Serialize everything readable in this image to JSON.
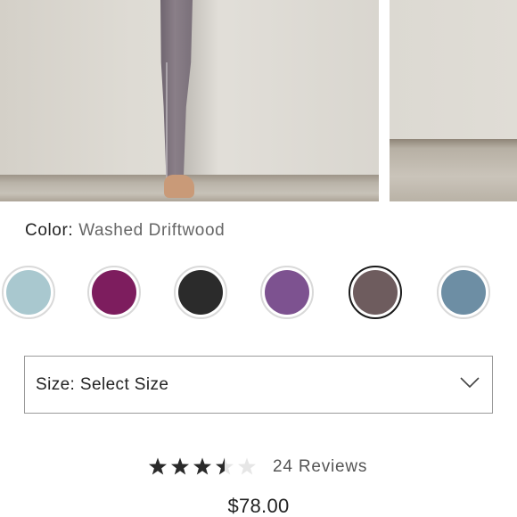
{
  "product": {
    "color_label": "Color:",
    "color_value": "Washed Driftwood",
    "swatches": [
      {
        "name": "light-blue",
        "color": "#a9c8cf",
        "selected": false
      },
      {
        "name": "magenta",
        "color": "#7d1d5e",
        "selected": false
      },
      {
        "name": "black",
        "color": "#2b2b2b",
        "selected": false
      },
      {
        "name": "purple",
        "color": "#7d5290",
        "selected": false
      },
      {
        "name": "washed-driftwood",
        "color": "#6e5c5e",
        "selected": true
      },
      {
        "name": "slate-blue",
        "color": "#6d8ea4",
        "selected": false
      }
    ],
    "size_select": {
      "label": "Size: Select Size",
      "icon": "chevron-down-icon"
    },
    "rating": {
      "value": 3.5,
      "max": 5,
      "reviews_text": "24 Reviews"
    },
    "price": "$78.00"
  },
  "colors": {
    "star_filled": "#2a2a2a",
    "star_empty": "#e6e6e6",
    "select_border": "#9a9a9a",
    "swatch_ring": "#d9d9d9",
    "swatch_selected_ring": "#1a1a1a"
  }
}
